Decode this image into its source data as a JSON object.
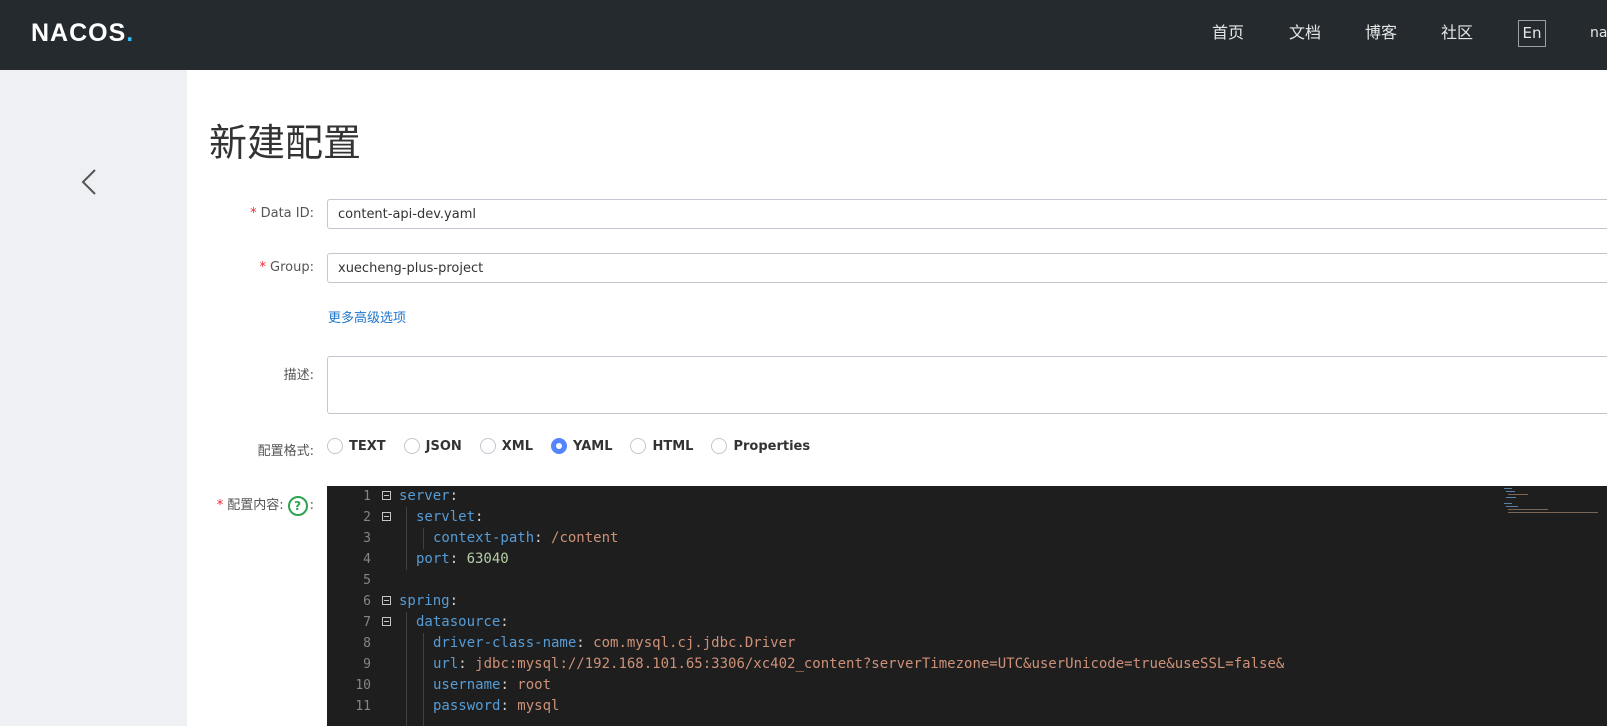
{
  "topbar": {
    "logo": "NACOS",
    "logo_dot": ".",
    "nav": [
      "首页",
      "文档",
      "博客",
      "社区"
    ],
    "lang": "En",
    "user": "nacos"
  },
  "sidebar": {
    "back_icon": "chevron-left-icon"
  },
  "page": {
    "title": "新建配置"
  },
  "form": {
    "data_id": {
      "label": "Data ID:",
      "value": "content-api-dev.yaml"
    },
    "group": {
      "label": "Group:",
      "value": "xuecheng-plus-project"
    },
    "more_options": "更多高级选项",
    "description": {
      "label": "描述:",
      "value": ""
    },
    "format": {
      "label": "配置格式:",
      "options": [
        "TEXT",
        "JSON",
        "XML",
        "YAML",
        "HTML",
        "Properties"
      ],
      "selected": "YAML"
    },
    "content": {
      "label": "配置内容:",
      "help": "?",
      "colon": ":"
    }
  },
  "editor": {
    "lines": [
      {
        "n": "1",
        "key": "server",
        "val": ""
      },
      {
        "n": "2",
        "key": "servlet",
        "val": ""
      },
      {
        "n": "3",
        "key": "context-path",
        "val": "/content"
      },
      {
        "n": "4",
        "key": "port",
        "val": "63040"
      },
      {
        "n": "5",
        "key": "",
        "val": ""
      },
      {
        "n": "6",
        "key": "spring",
        "val": ""
      },
      {
        "n": "7",
        "key": "datasource",
        "val": ""
      },
      {
        "n": "8",
        "key": "driver-class-name",
        "val": "com.mysql.cj.jdbc.Driver"
      },
      {
        "n": "9",
        "key": "url",
        "val": "jdbc:mysql://192.168.101.65:3306/xc402_content?serverTimezone=UTC&userUnicode=true&useSSL=false&"
      },
      {
        "n": "10",
        "key": "username",
        "val": "root"
      },
      {
        "n": "11",
        "key": "password",
        "val": "mysql"
      }
    ]
  }
}
